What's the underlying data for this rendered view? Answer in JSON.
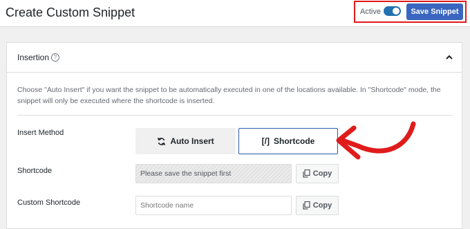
{
  "header": {
    "title": "Create Custom Snippet",
    "active_label": "Active",
    "active_state": true,
    "save_label": "Save Snippet"
  },
  "insertion": {
    "title": "Insertion",
    "help_icon": "question-circle-icon",
    "collapse_icon": "chevron-up-icon",
    "description": "Choose \"Auto Insert\" if you want the snippet to be automatically executed in one of the locations available. In \"Shortcode\" mode, the snippet will only be executed where the shortcode is inserted.",
    "insert_method": {
      "label": "Insert Method",
      "options": [
        {
          "label": "Auto Insert",
          "icon": "refresh-icon",
          "selected": false
        },
        {
          "label": "Shortcode",
          "icon": "shortcode-icon",
          "selected": true
        }
      ],
      "shortcode_glyph": "[/]"
    },
    "shortcode": {
      "label": "Shortcode",
      "value": "Please save the snippet first",
      "copy_label": "Copy"
    },
    "custom_shortcode": {
      "label": "Custom Shortcode",
      "placeholder": "Shortcode name",
      "copy_label": "Copy"
    }
  },
  "colors": {
    "accent": "#3a66c0",
    "highlight": "#e01b1b",
    "annotation_arrow": "#e01b1b"
  }
}
